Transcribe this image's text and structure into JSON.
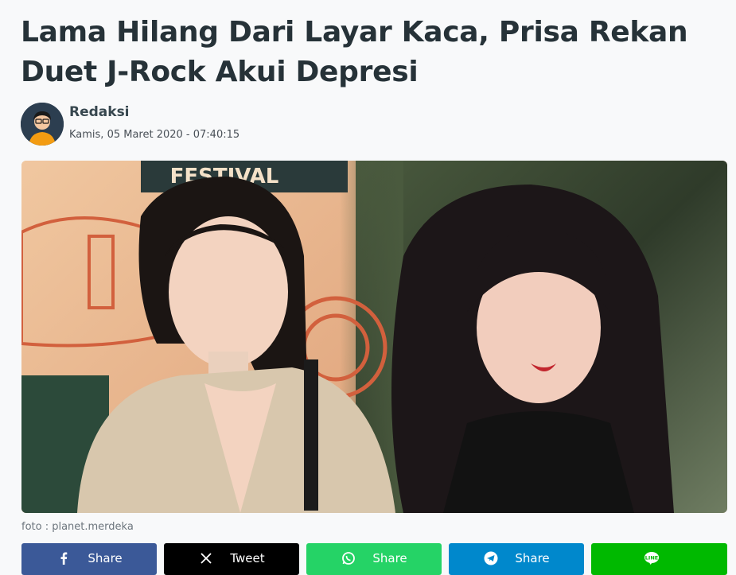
{
  "article": {
    "title": "Lama Hilang Dari Layar Kaca, Prisa Rekan Duet J-Rock Akui Depresi",
    "author": "Redaksi",
    "date": "Kamis, 05 Maret 2020 - 07:40:15",
    "photo_caption": "foto : planet.merdeka",
    "photo_banner_text": "FESTIVAL"
  },
  "share": {
    "facebook": {
      "icon": "facebook-icon",
      "label": "Share",
      "color": "#3b5998"
    },
    "x": {
      "icon": "x-icon",
      "label": "Tweet",
      "color": "#000000"
    },
    "whatsapp": {
      "icon": "whatsapp-icon",
      "label": "Share",
      "color": "#25d366"
    },
    "telegram": {
      "icon": "telegram-icon",
      "label": "Share",
      "color": "#0088cc"
    },
    "line": {
      "icon": "line-icon",
      "label": "",
      "color": "#00b900"
    }
  }
}
